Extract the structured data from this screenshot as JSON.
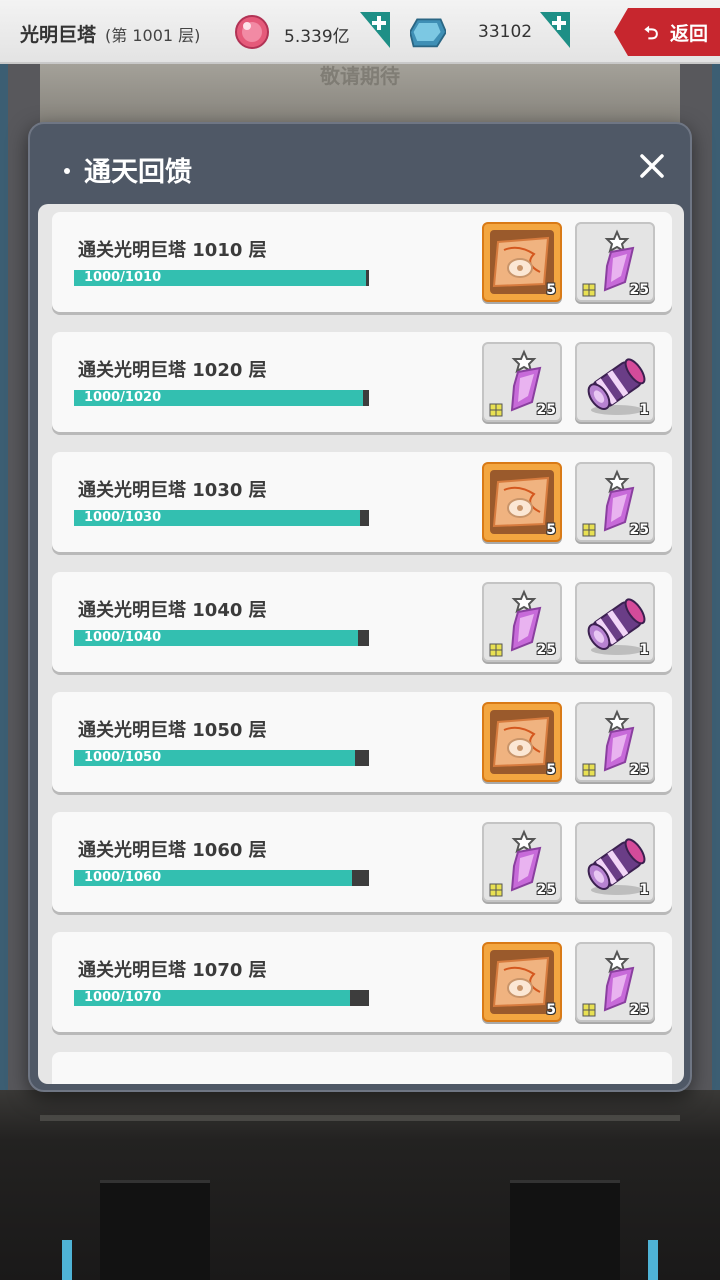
{
  "header": {
    "title": "光明巨塔",
    "floor_label": "(第 1001 层)",
    "currency1": "5.339亿",
    "currency2": "33102",
    "back_label": "返回",
    "back_icon": "return-arrow-icon",
    "ghost_title": "敬请期待"
  },
  "colors": {
    "progress_fill": "#33bfb0",
    "progress_track": "#3d3d3d",
    "back_button": "#c7262e",
    "modal_bg": "#4f5866"
  },
  "modal": {
    "title": "通天回馈",
    "rows": [
      {
        "title": "通关光明巨塔 1010 层",
        "progress_text": "1000/1010",
        "progress": 0.9901,
        "items": [
          {
            "icon": "treasure-map-icon",
            "qty": "5"
          },
          {
            "icon": "purple-crystal-icon",
            "qty": "25"
          }
        ]
      },
      {
        "title": "通关光明巨塔 1020 层",
        "progress_text": "1000/1020",
        "progress": 0.9804,
        "items": [
          {
            "icon": "purple-crystal-icon",
            "qty": "25"
          },
          {
            "icon": "purple-scroll-icon",
            "qty": "1"
          }
        ]
      },
      {
        "title": "通关光明巨塔 1030 层",
        "progress_text": "1000/1030",
        "progress": 0.9709,
        "items": [
          {
            "icon": "treasure-map-icon",
            "qty": "5"
          },
          {
            "icon": "purple-crystal-icon",
            "qty": "25"
          }
        ]
      },
      {
        "title": "通关光明巨塔 1040 层",
        "progress_text": "1000/1040",
        "progress": 0.9615,
        "items": [
          {
            "icon": "purple-crystal-icon",
            "qty": "25"
          },
          {
            "icon": "purple-scroll-icon",
            "qty": "1"
          }
        ]
      },
      {
        "title": "通关光明巨塔 1050 层",
        "progress_text": "1000/1050",
        "progress": 0.9524,
        "items": [
          {
            "icon": "treasure-map-icon",
            "qty": "5"
          },
          {
            "icon": "purple-crystal-icon",
            "qty": "25"
          }
        ]
      },
      {
        "title": "通关光明巨塔 1060 层",
        "progress_text": "1000/1060",
        "progress": 0.9434,
        "items": [
          {
            "icon": "purple-crystal-icon",
            "qty": "25"
          },
          {
            "icon": "purple-scroll-icon",
            "qty": "1"
          }
        ]
      },
      {
        "title": "通关光明巨塔 1070 层",
        "progress_text": "1000/1070",
        "progress": 0.9346,
        "items": [
          {
            "icon": "treasure-map-icon",
            "qty": "5"
          },
          {
            "icon": "purple-crystal-icon",
            "qty": "25"
          }
        ]
      }
    ]
  }
}
